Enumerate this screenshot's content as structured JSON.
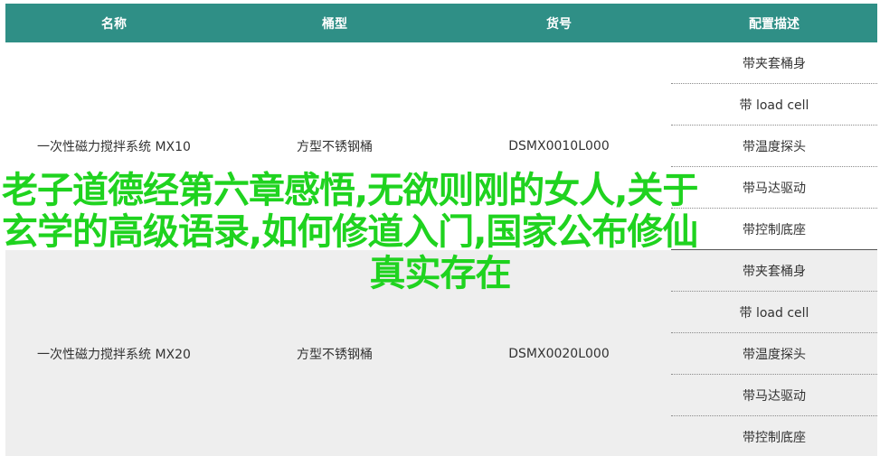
{
  "table": {
    "headers": [
      "名称",
      "桶型",
      "货号",
      "配置描述"
    ],
    "groups": [
      {
        "name": "一次性磁力搅拌系统 MX10",
        "tank": "方型不锈钢桶",
        "sku": "DSMX0010L000",
        "configs": [
          "带夹套桶身",
          "带 load cell",
          "带温度探头",
          "带马达驱动",
          "带控制底座"
        ]
      },
      {
        "name": "一次性磁力搅拌系统 MX20",
        "tank": "方型不锈钢桶",
        "sku": "DSMX0020L000",
        "configs": [
          "带夹套桶身",
          "带 load cell",
          "带温度探头",
          "带马达驱动",
          "带控制底座"
        ]
      }
    ]
  },
  "overlay": {
    "line1": "老子道德经第六章感悟,无欲则刚的女人,关于",
    "line2": "玄学的高级语录,如何修道入门,国家公布修仙",
    "line3": "真实存在"
  },
  "colors": {
    "header_bg": "#2f8f86",
    "overlay_text": "#1fd31f",
    "group_b_bg": "#eeeeee"
  }
}
